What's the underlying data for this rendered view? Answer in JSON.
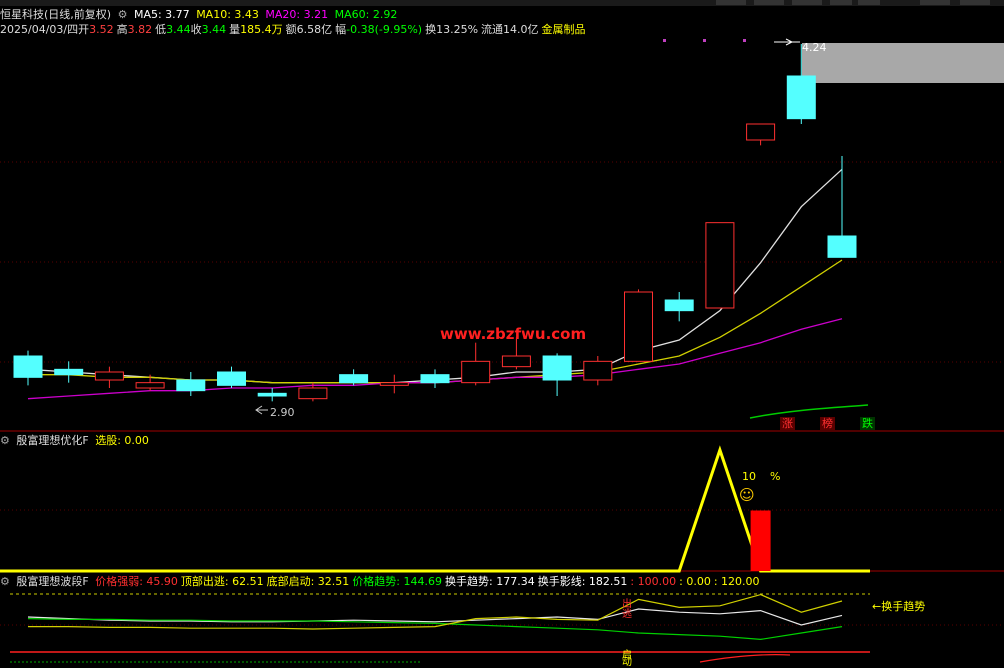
{
  "main_header": {
    "title": "恒星科技(日线,前复权)",
    "ma5": "MA5: 3.77",
    "ma10": "MA10: 3.43",
    "ma20": "MA20: 3.21",
    "ma60": "MA60: 2.92",
    "colors": {
      "ma5": "#ffffff",
      "ma10": "#ffff00",
      "ma20": "#ff00ff",
      "ma60": "#00ff00"
    }
  },
  "quote_line": {
    "date": "2025/04/03/四",
    "open_label": "开",
    "open": "3.52",
    "high_label": "高",
    "high": "3.82",
    "low_label": "低",
    "low": "3.44",
    "close_label": "收",
    "close": "3.44",
    "volume_label": "量",
    "volume": "185.4万",
    "amount_label": "额",
    "amount": "6.58亿",
    "change_label": "幅",
    "change": "-0.38(-9.95%)",
    "turnover_label": "换",
    "turnover": "13.25%",
    "float_label": "流通",
    "float": "14.0亿",
    "sector": "金属制品"
  },
  "price_marks": {
    "high": "4.24",
    "low": "2.90"
  },
  "watermark": "www.zbzfwu.com",
  "badges": {
    "up": "涨",
    "list": "榜",
    "down": "跌"
  },
  "indicator1": {
    "title": "殷富理想优化F",
    "select_label": "选股: 0.00",
    "percent_value": "10",
    "percent_sign": "%",
    "smiley": "☺"
  },
  "indicator2": {
    "title": "殷富理想波段F",
    "items": [
      {
        "text": "价格强弱: 45.90",
        "color": "#ff3030"
      },
      {
        "text": "顶部出逃: 62.51",
        "color": "#ffff00"
      },
      {
        "text": "底部启动: 32.51",
        "color": "#ffff00"
      },
      {
        "text": "价格趋势: 144.69",
        "color": "#00ff00"
      },
      {
        "text": "换手趋势: 177.34",
        "color": "#ffffff"
      },
      {
        "text": "换手影线: 182.51",
        "color": "#ffffff"
      },
      {
        "text": ": 100.00",
        "color": "#ff3030"
      },
      {
        "text": ": 0.00",
        "color": "#ffff00"
      },
      {
        "text": ": 120.00",
        "color": "#ffff00"
      }
    ],
    "arrow_label": "←换手趋势",
    "signal_top": "出逃",
    "signal_bottom": "启动"
  },
  "chart_data": {
    "type": "candlestick",
    "ylim": [
      2.8,
      4.3
    ],
    "candles": [
      {
        "o": 3.07,
        "c": 2.99,
        "h": 3.09,
        "l": 2.96
      },
      {
        "o": 3.02,
        "c": 3.0,
        "h": 3.05,
        "l": 2.97
      },
      {
        "o": 2.98,
        "c": 3.01,
        "h": 3.03,
        "l": 2.95
      },
      {
        "o": 2.95,
        "c": 2.97,
        "h": 3.0,
        "l": 2.94
      },
      {
        "o": 2.98,
        "c": 2.94,
        "h": 3.01,
        "l": 2.92
      },
      {
        "o": 3.01,
        "c": 2.96,
        "h": 3.03,
        "l": 2.95
      },
      {
        "o": 2.93,
        "c": 2.92,
        "h": 2.95,
        "l": 2.9
      },
      {
        "o": 2.91,
        "c": 2.95,
        "h": 2.97,
        "l": 2.9
      },
      {
        "o": 3.0,
        "c": 2.97,
        "h": 3.02,
        "l": 2.96
      },
      {
        "o": 2.96,
        "c": 2.97,
        "h": 3.0,
        "l": 2.93
      },
      {
        "o": 3.0,
        "c": 2.97,
        "h": 3.02,
        "l": 2.95
      },
      {
        "o": 2.97,
        "c": 3.05,
        "h": 3.12,
        "l": 2.96
      },
      {
        "o": 3.03,
        "c": 3.07,
        "h": 3.14,
        "l": 3.02
      },
      {
        "o": 3.07,
        "c": 2.98,
        "h": 3.08,
        "l": 2.92
      },
      {
        "o": 2.98,
        "c": 3.05,
        "h": 3.07,
        "l": 2.96
      },
      {
        "o": 3.05,
        "c": 3.31,
        "h": 3.32,
        "l": 3.05
      },
      {
        "o": 3.28,
        "c": 3.24,
        "h": 3.31,
        "l": 3.2
      },
      {
        "o": 3.25,
        "c": 3.57,
        "h": 3.57,
        "l": 3.25
      },
      {
        "o": 3.88,
        "c": 3.94,
        "h": 3.94,
        "l": 3.86
      },
      {
        "o": 4.12,
        "c": 3.96,
        "h": 4.24,
        "l": 3.94
      },
      {
        "o": 3.52,
        "c": 3.44,
        "h": 3.82,
        "l": 3.44
      }
    ],
    "ma5": [
      3.02,
      3.01,
      3.0,
      2.99,
      2.98,
      2.98,
      2.97,
      2.97,
      2.97,
      2.97,
      2.98,
      2.99,
      3.01,
      3.01,
      3.02,
      3.09,
      3.13,
      3.24,
      3.42,
      3.63,
      3.77
    ],
    "ma10": [
      3.0,
      3.0,
      2.99,
      2.99,
      2.98,
      2.98,
      2.97,
      2.97,
      2.97,
      2.97,
      2.97,
      2.98,
      2.99,
      3.0,
      3.01,
      3.04,
      3.07,
      3.14,
      3.23,
      3.33,
      3.43
    ],
    "ma20": [
      2.91,
      2.92,
      2.93,
      2.94,
      2.94,
      2.95,
      2.95,
      2.96,
      2.96,
      2.97,
      2.97,
      2.98,
      2.99,
      2.99,
      3.0,
      3.02,
      3.04,
      3.08,
      3.12,
      3.17,
      3.21
    ],
    "indicator1_line": [
      0,
      0,
      0,
      0,
      0,
      0,
      0,
      0,
      0,
      0,
      0,
      0,
      0,
      0,
      0,
      0,
      0,
      100,
      0,
      0,
      0
    ],
    "indicator1_bar": 10,
    "indicator2_white": [
      60,
      58,
      56,
      55,
      55,
      54,
      54,
      55,
      56,
      55,
      54,
      56,
      58,
      60,
      57,
      70,
      66,
      64,
      68,
      50,
      62
    ],
    "indicator2_green": [
      58,
      57,
      57,
      56,
      56,
      55,
      55,
      55,
      54,
      53,
      52,
      50,
      48,
      46,
      44,
      40,
      38,
      36,
      32,
      40,
      48
    ],
    "indicator2_yellow": [
      48,
      48,
      47,
      47,
      46,
      46,
      46,
      45,
      46,
      47,
      48,
      58,
      60,
      57,
      56,
      82,
      72,
      74,
      88,
      66,
      80
    ]
  }
}
